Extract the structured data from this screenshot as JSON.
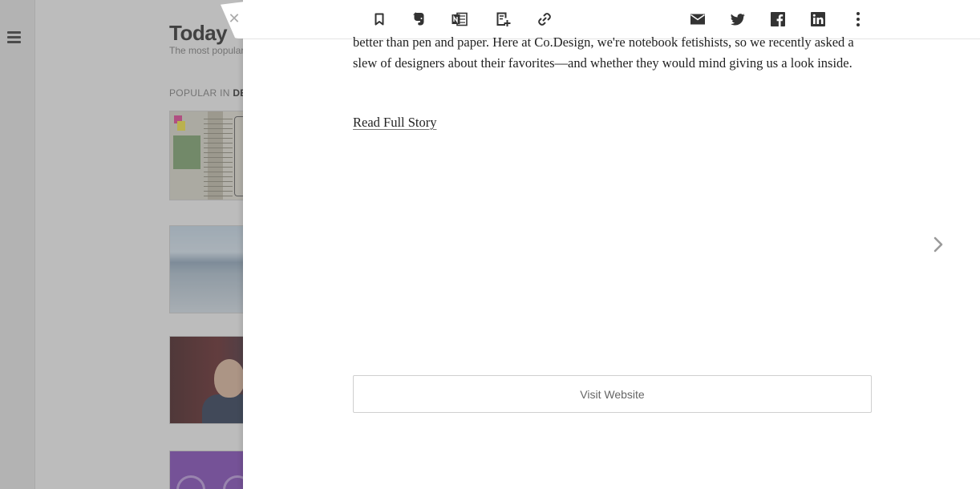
{
  "background": {
    "menu_icon": "hamburger-icon",
    "title": "Today",
    "subtitle": "The most popular",
    "section_prefix": "POPULAR IN ",
    "section_topic": "DE"
  },
  "overlay": {
    "close_icon": "close-icon",
    "toolbar": {
      "left": [
        {
          "icon": "bookmark-icon"
        },
        {
          "icon": "evernote-icon"
        },
        {
          "icon": "onenote-icon"
        },
        {
          "icon": "add-to-board-icon"
        },
        {
          "icon": "link-icon"
        }
      ],
      "right": [
        {
          "icon": "email-icon"
        },
        {
          "icon": "twitter-icon"
        },
        {
          "icon": "facebook-icon"
        },
        {
          "icon": "linkedin-icon"
        },
        {
          "icon": "more-icon"
        }
      ]
    },
    "article": {
      "body": "better than pen and paper. Here at Co.Design, we're notebook fetishists, so we recently asked a slew of designers about their favorites—and whether they would mind giving us a look inside.",
      "read_full": "Read Full Story"
    },
    "next_icon": "chevron-right-icon",
    "visit_button": "Visit Website"
  }
}
